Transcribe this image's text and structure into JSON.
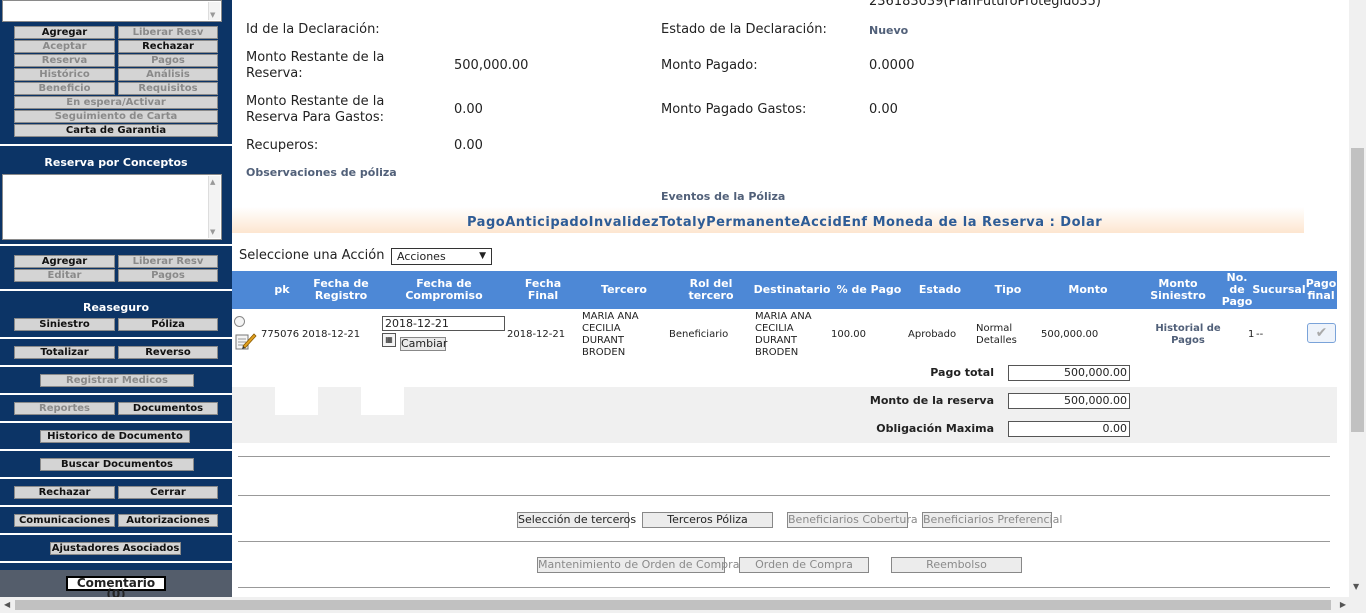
{
  "sidebar": {
    "top_buttons": {
      "agregar": "Agregar",
      "liberar_resv": "Liberar Resv",
      "aceptar": "Aceptar",
      "rechazar": "Rechazar",
      "reserva": "Reserva",
      "pagos": "Pagos",
      "historico": "Histórico",
      "analisis": "Análisis",
      "beneficio": "Beneficio",
      "requisitos": "Requisitos",
      "en_espera": "En espera/Activar",
      "seguimiento": "Seguimiento de Carta",
      "carta_garantia": "Carta de Garantia"
    },
    "reserva_conceptos_title": "Reserva por Conceptos",
    "reserva_buttons": {
      "agregar": "Agregar",
      "liberar_resv": "Liberar Resv",
      "editar": "Editar",
      "pagos": "Pagos"
    },
    "reaseguro_title": "Reaseguro",
    "buttons": {
      "siniestro": "Siniestro",
      "poliza": "Póliza",
      "totalizar": "Totalizar",
      "reverso": "Reverso",
      "registrar_medicos": "Registrar Medicos",
      "reportes": "Reportes",
      "documentos": "Documentos",
      "historico_documento": "Historico de Documento",
      "buscar_documentos": "Buscar Documentos",
      "rechazar": "Rechazar",
      "cerrar": "Cerrar",
      "comunicaciones": "Comunicaciones",
      "autorizaciones": "Autorizaciones",
      "ajustadores": "Ajustadores Asociados"
    },
    "comentario": "Comentario (0)"
  },
  "main": {
    "top_partial": "236183039(PlanFuturoProtegido35)",
    "id_declaracion_label": "Id de la Declaración:",
    "estado_declaracion_label": "Estado de la Declaración:",
    "estado_declaracion_value": "Nuevo",
    "monto_restante_reserva_label": "Monto Restante de la Reserva:",
    "monto_restante_reserva_value": "500,000.00",
    "monto_pagado_label": "Monto Pagado:",
    "monto_pagado_value": "0.0000",
    "monto_restante_gastos_label": "Monto Restante de la Reserva Para Gastos:",
    "monto_restante_gastos_value": "0.00",
    "monto_pagado_gastos_label": "Monto Pagado Gastos:",
    "monto_pagado_gastos_value": "0.00",
    "recuperos_label": "Recuperos:",
    "recuperos_value": "0.00",
    "observaciones_label": "Observaciones de póliza",
    "eventos_label": "Eventos de la Póliza",
    "banner": "PagoAnticipadoInvalidezTotalyPermanenteAccidEnf   Moneda de la Reserva : Dolar",
    "accion_label": "Seleccione una Acción",
    "accion_select": "Acciones"
  },
  "table": {
    "headers": {
      "pk": "pk",
      "fecha_registro": "Fecha de Registro",
      "fecha_compromiso": "Fecha de Compromiso",
      "fecha_final": "Fecha Final",
      "tercero": "Tercero",
      "rol_tercero": "Rol del tercero",
      "destinatario": "Destinatario",
      "pct_pago": "% de Pago",
      "estado": "Estado",
      "tipo": "Tipo",
      "monto": "Monto",
      "monto_siniestro": "Monto Siniestro",
      "no_pago": "No. de Pago",
      "sucursal": "Sucursal",
      "pago_final": "Pago final"
    },
    "row": {
      "pk": "775076",
      "fecha_registro": "2018-12-21",
      "fecha_compromiso": "2018-12-21",
      "cambiar": "Cambiar",
      "fecha_final": "2018-12-21",
      "tercero": "MARIA ANA CECILIA DURANT BRODEN",
      "rol_tercero": "Beneficiario",
      "destinatario": "MARIA ANA CECILIA DURANT BRODEN",
      "pct_pago": "100.00",
      "estado": "Aprobado",
      "tipo_1": "Normal",
      "tipo_2": "Detalles",
      "monto": "500,000.00",
      "monto_siniestro": "Historial de Pagos",
      "no_pago": "1",
      "sucursal": "--"
    }
  },
  "totals": {
    "pago_total_label": "Pago total",
    "pago_total_value": "500,000.00",
    "monto_reserva_label": "Monto de la reserva",
    "monto_reserva_value": "500,000.00",
    "obligacion_label": "Obligación Maxima",
    "obligacion_value": "0.00"
  },
  "bottom_buttons": {
    "seleccion_terceros": "Selección de terceros",
    "terceros_poliza": "Terceros Póliza",
    "beneficiarios_cobertura": "Beneficiarios Cobertura",
    "beneficiarios_preferencial": "Beneficiarios Preferencial",
    "mantenimiento_oc": "Mantenimiento de Orden de Compra",
    "orden_compra": "Orden de Compra",
    "reembolso": "Reembolso"
  }
}
